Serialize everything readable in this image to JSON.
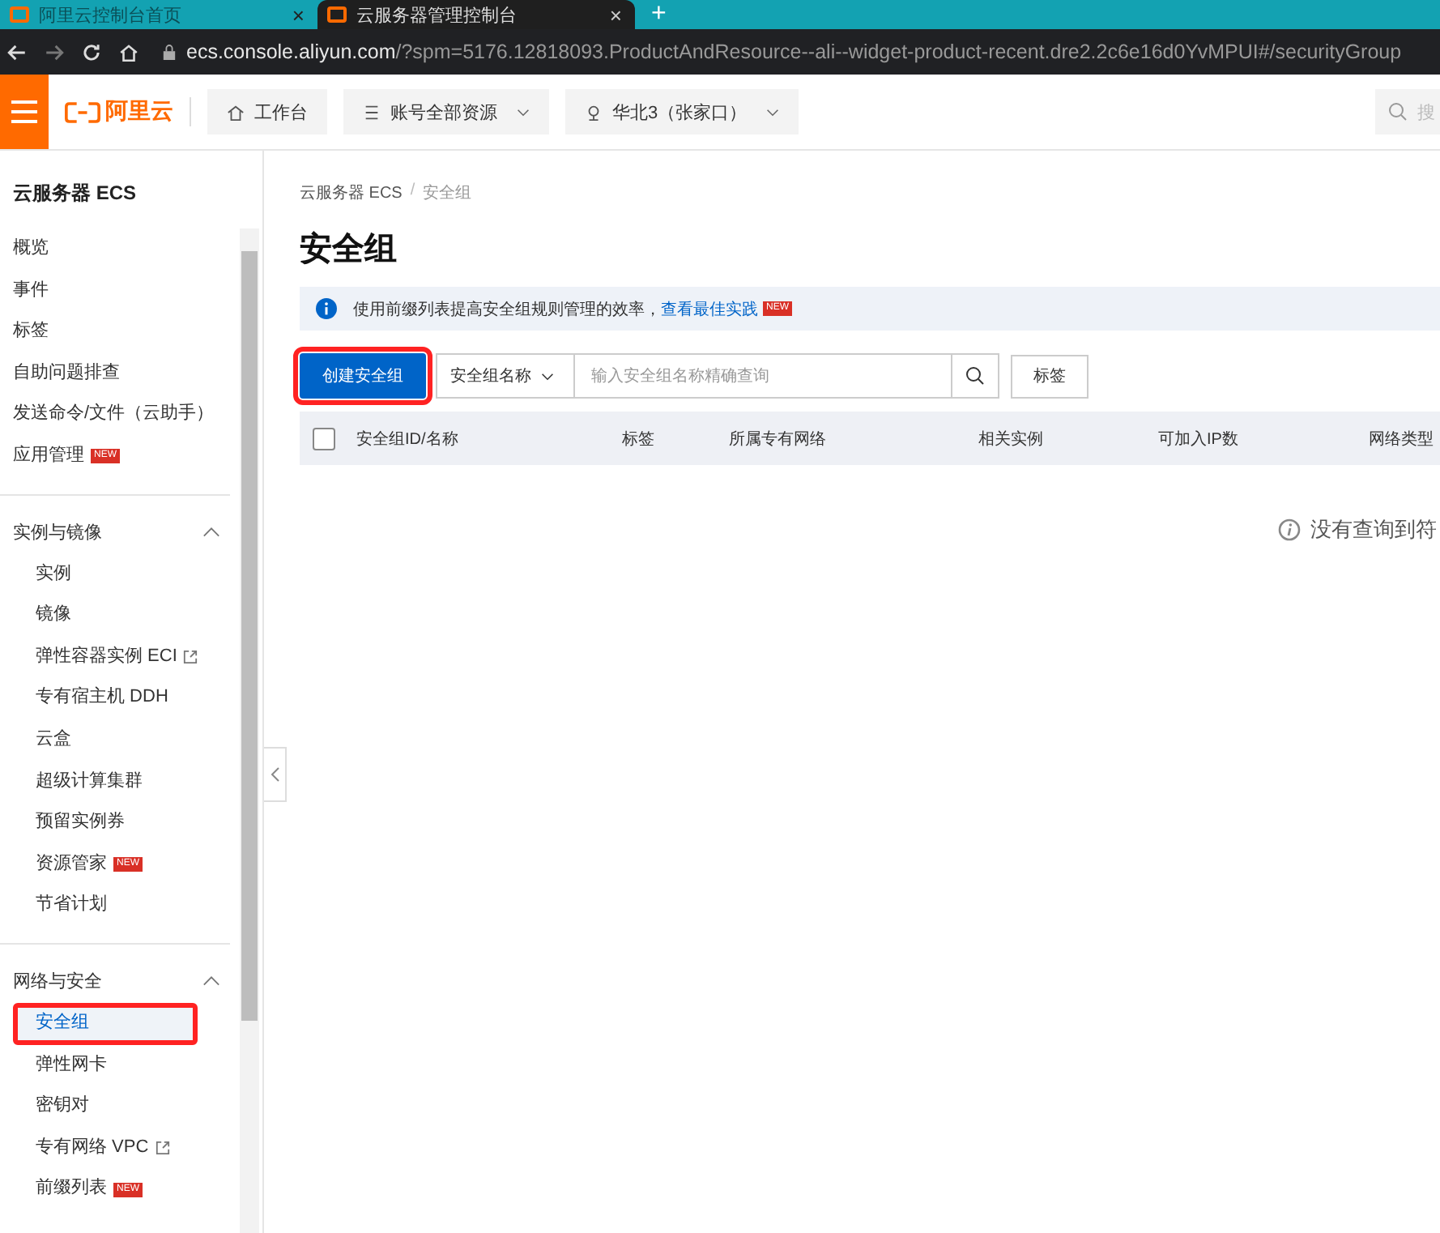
{
  "browser": {
    "tabs": [
      {
        "title": "阿里云控制台首页",
        "close": "×",
        "selected": false
      },
      {
        "title": "云服务器管理控制台",
        "close": "×",
        "selected": true
      }
    ],
    "new_tab": "+",
    "address": "ecs.console.aliyun.com",
    "address_rest": "/?spm=5176.12818093.ProductAndResource--ali--widget-product-recent.dre2.2c6e16d0YvMPUI#/securityGroup"
  },
  "header": {
    "logo": "阿里云",
    "nav": [
      {
        "label": "工作台",
        "kind": "home"
      },
      {
        "label": "账号全部资源",
        "kind": "dropdown"
      },
      {
        "label": "华北3（张家口）",
        "kind": "region"
      }
    ],
    "search": {
      "placeholder": "搜"
    }
  },
  "sidebar": {
    "title": "云服务器 ECS",
    "items": [
      {
        "label": "概览",
        "selected": false
      },
      {
        "label": "事件",
        "selected": false
      },
      {
        "label": "标签",
        "selected": false
      },
      {
        "label": "自助问题排查",
        "selected": false
      },
      {
        "label": "发送命令/文件（云助手）",
        "selected": false
      },
      {
        "label": "应用管理",
        "badge": "NEW",
        "selected": false
      }
    ],
    "groups": [
      {
        "label": "实例与镜像",
        "expanded": true,
        "children": [
          {
            "label": "实例",
            "selected": false
          },
          {
            "label": "镜像",
            "selected": false
          },
          {
            "label": "弹性容器实例 ECI",
            "external": true,
            "selected": false
          },
          {
            "label": "专有宿主机 DDH",
            "selected": false
          },
          {
            "label": "云盒",
            "selected": false
          },
          {
            "label": "超级计算集群",
            "selected": false
          },
          {
            "label": "预留实例券",
            "selected": false
          },
          {
            "label": "资源管家",
            "badge": "NEW",
            "selected": false
          },
          {
            "label": "节省计划",
            "selected": false
          }
        ]
      },
      {
        "label": "网络与安全",
        "expanded": true,
        "children": [
          {
            "label": "安全组",
            "selected": true,
            "highlighted": true
          },
          {
            "label": "弹性网卡",
            "selected": false
          },
          {
            "label": "密钥对",
            "selected": false
          },
          {
            "label": "专有网络 VPC",
            "external": true,
            "selected": false
          },
          {
            "label": "前缀列表",
            "badge": "NEW",
            "selected": false
          }
        ]
      }
    ]
  },
  "breadcrumb": [
    "云服务器 ECS",
    "/",
    "安全组"
  ],
  "page_title": "安全组",
  "alert": {
    "text": "使用前缀列表提高安全组规则管理的效率，",
    "link": "查看最佳实践",
    "badge": "NEW"
  },
  "toolbar": {
    "create_button": {
      "label": "创建安全组",
      "highlighted": true
    },
    "filter": "安全组名称",
    "search": {
      "placeholder": "输入安全组名称精确查询"
    },
    "tag_button": "标签"
  },
  "table": {
    "columns": [
      "安全组ID/名称",
      "标签",
      "所属专有网络",
      "相关实例",
      "可加入IP数",
      "网络类型"
    ],
    "select_all": {
      "checked": false
    },
    "empty_text": "没有查询到符"
  }
}
